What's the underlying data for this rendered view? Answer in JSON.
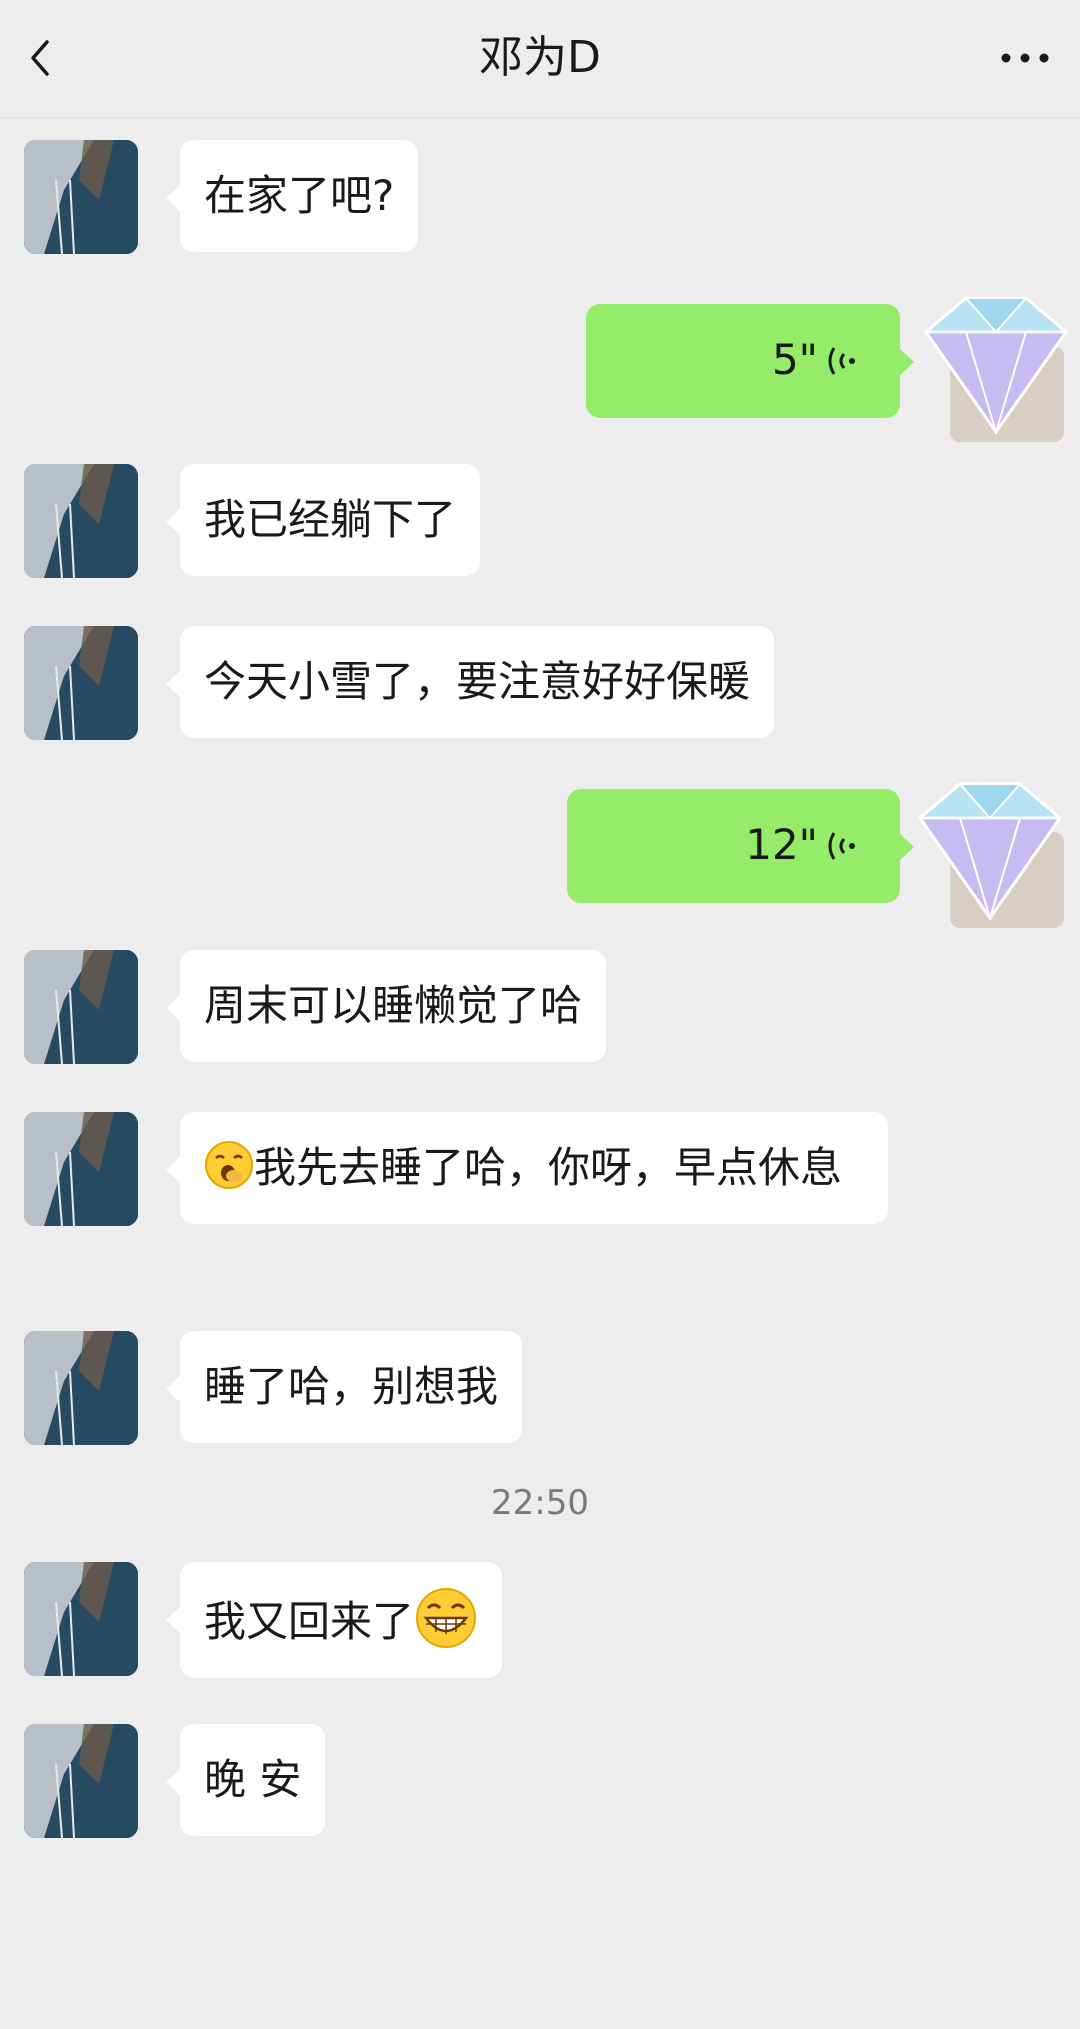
{
  "header": {
    "title": "邓为D",
    "back_icon": "chevron-left-icon",
    "more_icon": "more-dots-icon"
  },
  "messages": [
    {
      "side": "in",
      "type": "text",
      "text": "在家了吧?"
    },
    {
      "side": "out",
      "type": "voice",
      "duration": "5\""
    },
    {
      "side": "in",
      "type": "text",
      "text": "我已经躺下了"
    },
    {
      "side": "in",
      "type": "text",
      "text": "今天小雪了，要注意好好保暖"
    },
    {
      "side": "out",
      "type": "voice",
      "duration": "12\""
    },
    {
      "side": "in",
      "type": "text",
      "text": "周末可以睡懒觉了哈"
    },
    {
      "side": "in",
      "type": "text",
      "text": "我先去睡了哈，你呀，早点休息",
      "emoji_before": "yawn-emoji"
    },
    {
      "side": "in",
      "type": "text",
      "text": "睡了哈，别想我"
    },
    {
      "side": "in",
      "type": "text",
      "text": "我又回来了",
      "emoji_after": "grin-emoji"
    },
    {
      "side": "in",
      "type": "text",
      "text": "晚 安"
    }
  ],
  "timestamp": "22:50",
  "colors": {
    "background": "#ededed",
    "incoming_bubble": "#ffffff",
    "outgoing_bubble": "#95ec69",
    "timestamp_text": "#7a7a7a"
  }
}
